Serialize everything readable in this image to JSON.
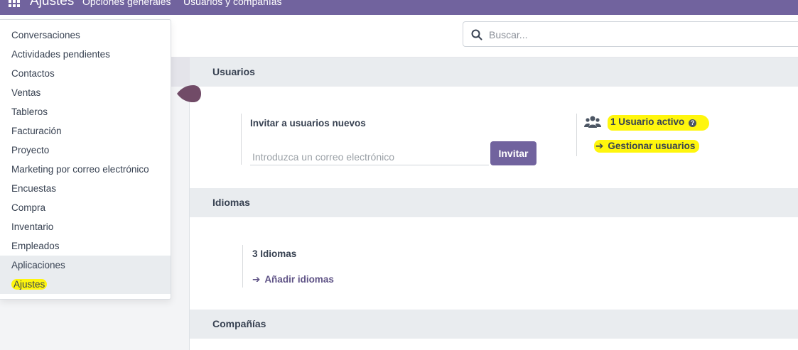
{
  "topbar": {
    "brand": "Ajustes",
    "menu": [
      "Opciones generales",
      "Usuarios y compañías"
    ]
  },
  "search": {
    "placeholder": "Buscar..."
  },
  "dropdown": {
    "items": [
      "Conversaciones",
      "Actividades pendientes",
      "Contactos",
      "Ventas",
      "Tableros",
      "Facturación",
      "Proyecto",
      "Marketing por correo electrónico",
      "Encuestas",
      "Compra",
      "Inventario",
      "Empleados",
      "Aplicaciones",
      "Ajustes"
    ]
  },
  "users": {
    "title": "Usuarios",
    "invite_label": "Invitar a usuarios nuevos",
    "invite_placeholder": "Introduzca un correo electrónico",
    "invite_button": "Invitar",
    "active_users": "1 Usuario activo",
    "manage_users": "Gestionar usuarios"
  },
  "languages": {
    "title": "Idiomas",
    "count": "3 Idiomas",
    "add": "Añadir idiomas"
  },
  "companies": {
    "title": "Compañías"
  },
  "colors": {
    "brand": "#71639e",
    "highlight": "#fff500",
    "section_bg": "#e9ecef"
  },
  "icons": {
    "apps": "apps-grid-icon",
    "search": "search-icon",
    "users": "users-icon",
    "help": "question-circle-icon",
    "arrow": "arrow-right-icon"
  }
}
